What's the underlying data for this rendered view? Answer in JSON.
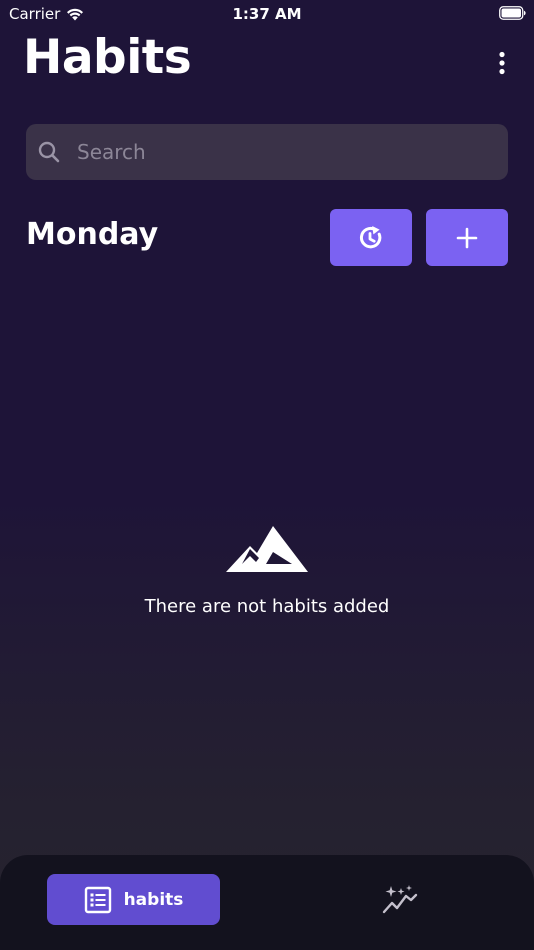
{
  "status_bar": {
    "carrier": "Carrier",
    "time": "1:37 AM"
  },
  "header": {
    "title": "Habits",
    "menu_icon": "more-vertical-icon"
  },
  "search": {
    "placeholder": "Search",
    "value": ""
  },
  "section": {
    "day": "Monday",
    "history_icon": "clock-history-icon",
    "add_icon": "plus-icon"
  },
  "empty_state": {
    "icon": "mountain-icon",
    "message": "There are not habits added"
  },
  "tab_bar": {
    "tabs": [
      {
        "label": "habits",
        "icon": "list-icon",
        "active": true
      },
      {
        "label": "",
        "icon": "sparkle-chart-icon",
        "active": false
      }
    ]
  },
  "colors": {
    "background": "#1e1438",
    "accent": "#7b62f2",
    "active_tab": "#614dd0",
    "search_bg": "#3a3248",
    "tab_bar_bg": "#13121e"
  }
}
